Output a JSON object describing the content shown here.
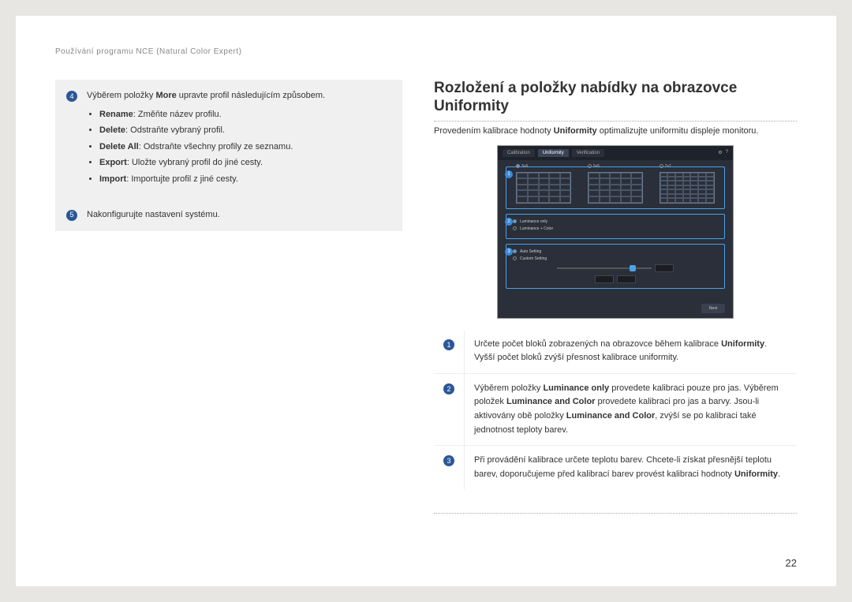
{
  "header": "Používání programu NCE (Natural Color Expert)",
  "page_number": "22",
  "left": {
    "step4": {
      "num": "4",
      "intro_pre": "Výběrem položky ",
      "intro_bold": "More",
      "intro_post": " upravte profil následujícím způsobem.",
      "items": [
        {
          "b": "Rename",
          "t": ": Změňte název profilu."
        },
        {
          "b": "Delete",
          "t": ": Odstraňte vybraný profil."
        },
        {
          "b": "Delete All",
          "t": ": Odstraňte všechny profily ze seznamu."
        },
        {
          "b": "Export",
          "t": ": Uložte vybraný profil do jiné cesty."
        },
        {
          "b": "Import",
          "t": ": Importujte profil z jiné cesty."
        }
      ]
    },
    "step5": {
      "num": "5",
      "text": "Nakonfigurujte nastavení systému."
    }
  },
  "right": {
    "title": "Rozložení a položky nabídky na obrazovce Uniformity",
    "intro_pre": "Provedením kalibrace hodnoty ",
    "intro_bold": "Uniformity",
    "intro_post": " optimalizujte uniformitu displeje monitoru.",
    "screenshot": {
      "tabs": [
        "Calibration",
        "Uniformity",
        "Verification"
      ],
      "grid_labels": [
        "5x5",
        "5x5",
        "7x7"
      ],
      "opts": [
        "Luminance only",
        "Luminance + Color"
      ],
      "section3_opts": [
        "Auto Setting",
        "Custom Setting"
      ],
      "next_btn": "Next"
    },
    "rows": [
      {
        "num": "1",
        "parts": [
          "Určete počet bloků zobrazených na obrazovce během kalibrace ",
          "Uniformity",
          ". Vyšší počet bloků zvýší přesnost kalibrace uniformity."
        ]
      },
      {
        "num": "2",
        "parts": [
          "Výběrem položky ",
          "Luminance only",
          " provedete kalibraci pouze pro jas. Výběrem položek ",
          "Luminance and Color",
          " provedete kalibraci pro jas a barvy. Jsou-li aktivovány obě položky ",
          "Luminance and Color",
          ", zvýší se po kalibraci také jednotnost teploty barev."
        ]
      },
      {
        "num": "3",
        "parts": [
          "Při provádění kalibrace určete teplotu barev. Chcete-li získat přesnější teplotu barev, doporučujeme před kalibrací barev provést kalibraci hodnoty ",
          "Uniformity",
          "."
        ]
      }
    ]
  }
}
